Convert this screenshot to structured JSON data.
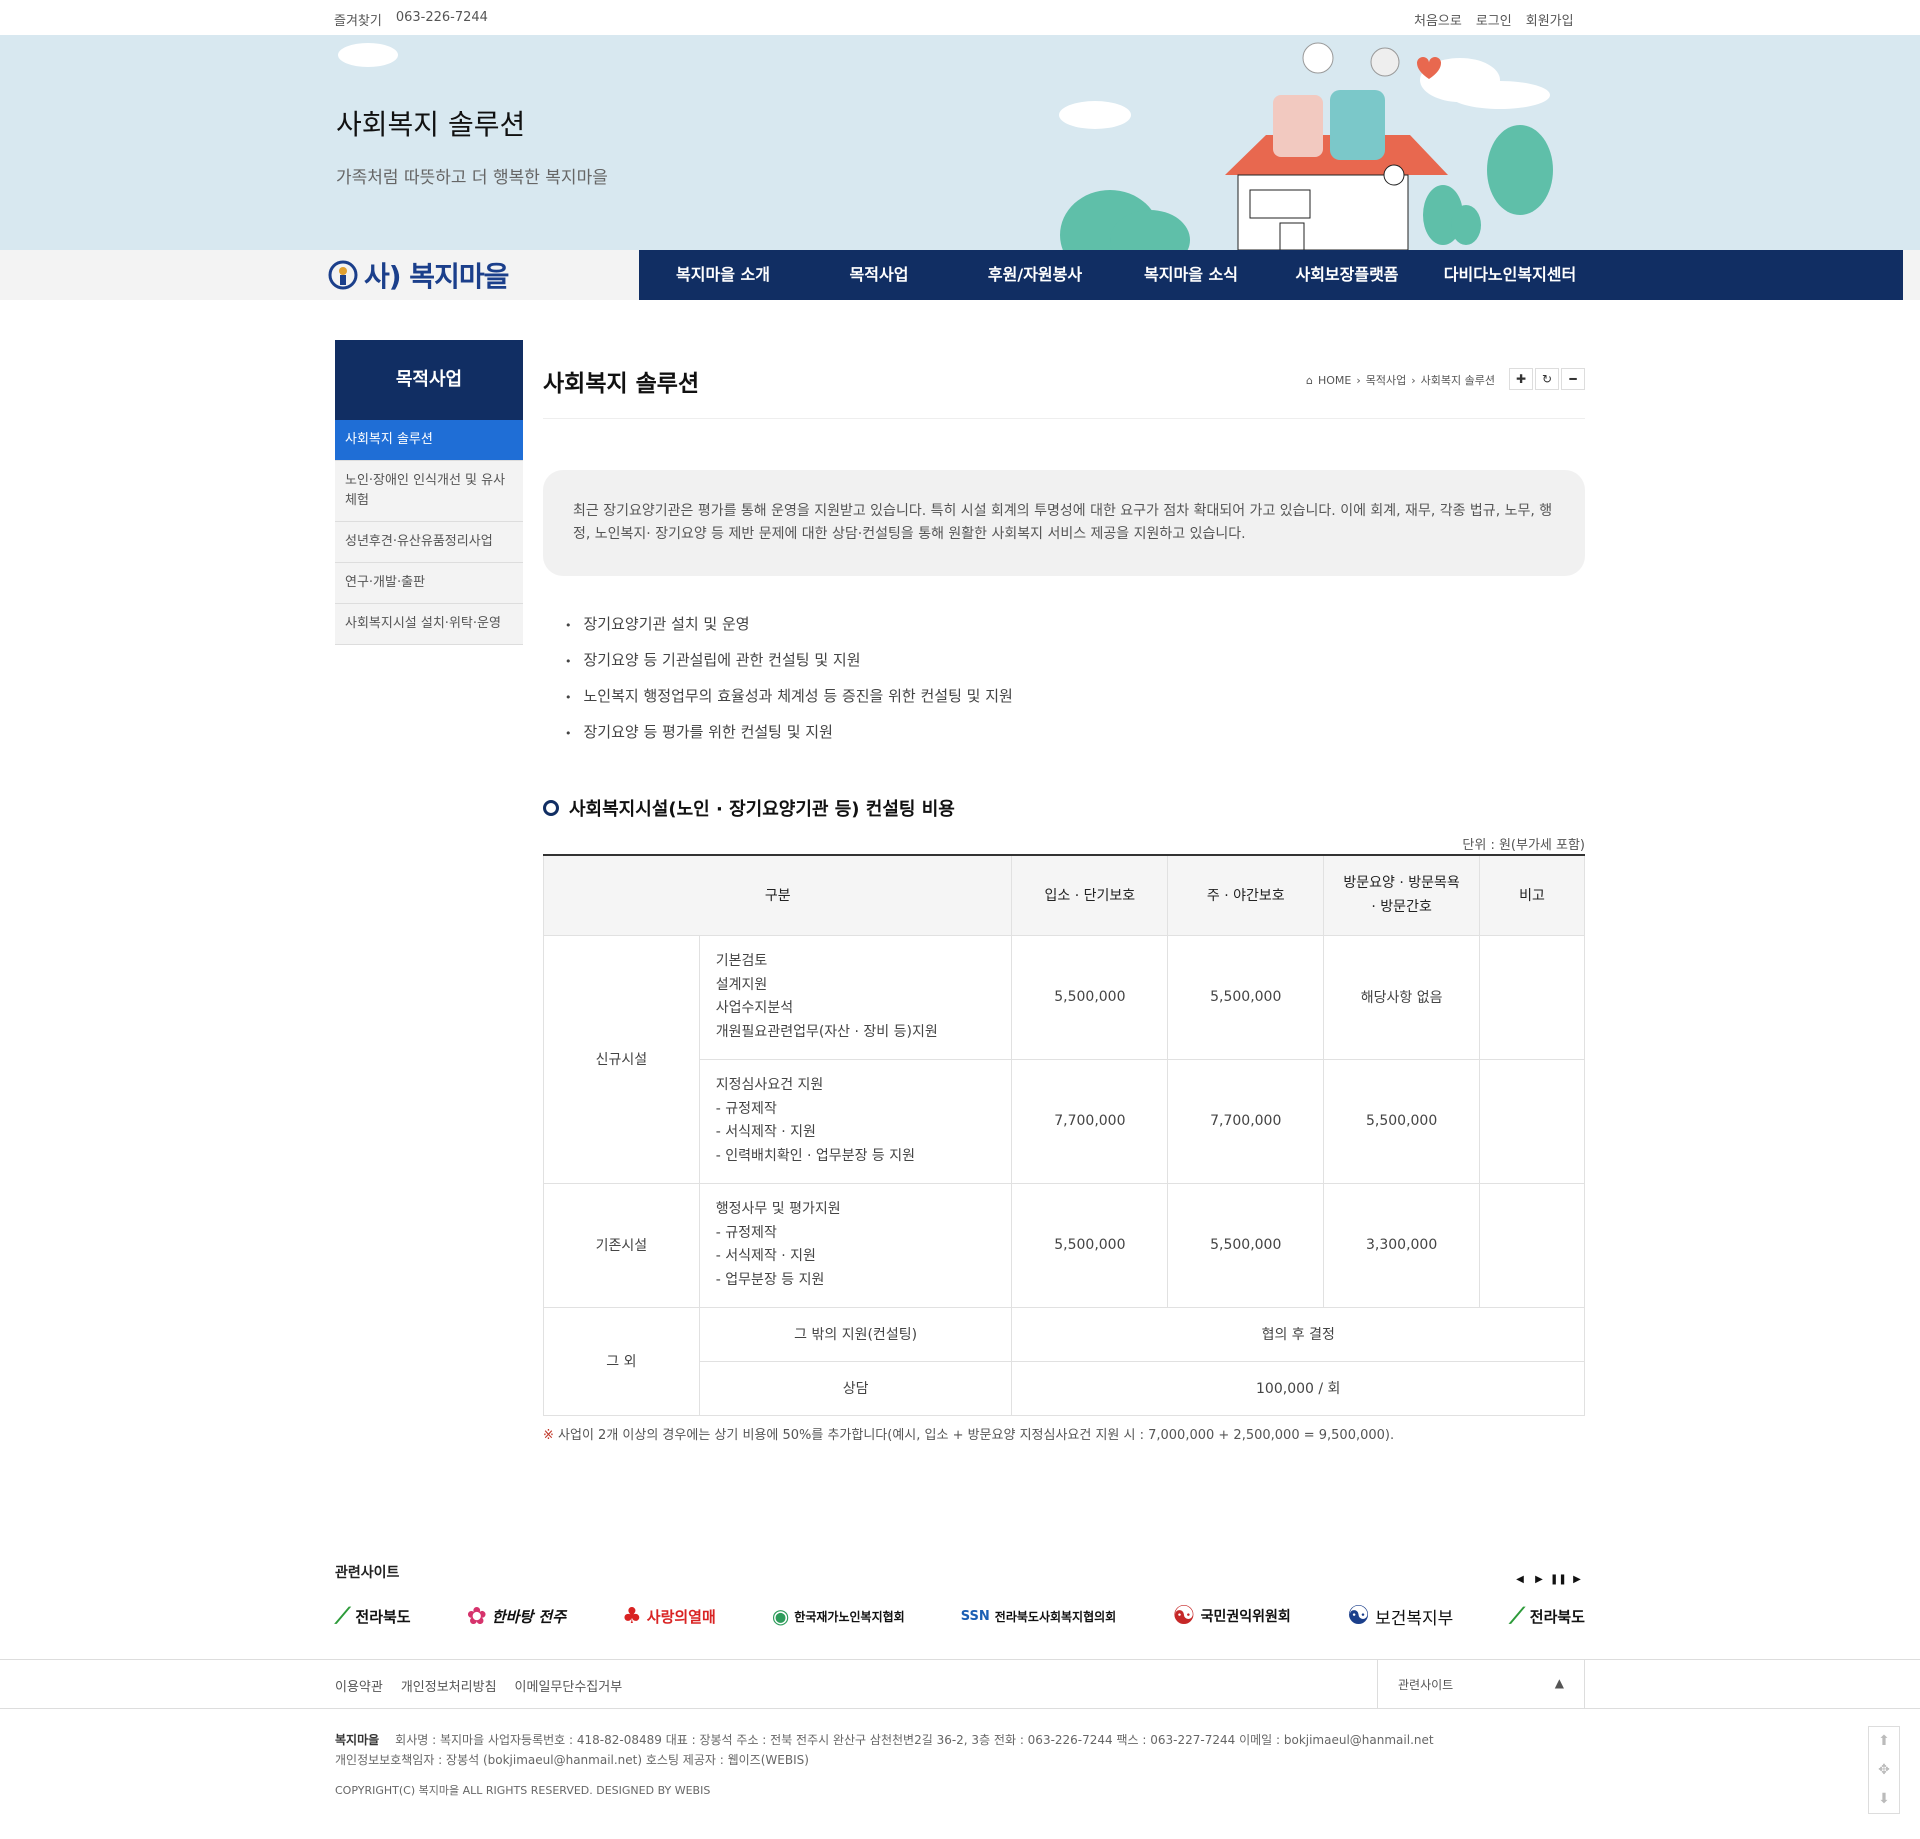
{
  "topbar": {
    "bookmark": "즐겨찾기",
    "phone": "063-226-7244",
    "home": "처음으로",
    "login": "로그인",
    "join": "회원가입"
  },
  "banner": {
    "title": "사회복지 솔루션",
    "subtitle": "가족처럼 따뜻하고 더 행복한 복지마을"
  },
  "logo": {
    "text": "사) 복지마을"
  },
  "gnb": [
    "복지마을 소개",
    "목적사업",
    "후원/자원봉사",
    "복지마을 소식",
    "사회보장플랫폼",
    "다비다노인복지센터"
  ],
  "lnb": {
    "title": "목적사업",
    "items": [
      "사회복지 솔루션",
      "노인·장애인 인식개선 및 유사체험",
      "성년후견·유산유품정리사업",
      "연구·개발·출판",
      "사회복지시설 설치·위탁·운영"
    ]
  },
  "page": {
    "title": "사회복지 솔루션",
    "breadcrumb": [
      "HOME",
      "목적사업",
      "사회복지 솔루션"
    ],
    "intro": "최근 장기요양기관은 평가를 통해 운영을 지원받고 있습니다. 특히 시설 회계의 투명성에 대한 요구가 점차 확대되어 가고 있습니다. 이에 회계, 재무, 각종 법규, 노무, 행정, 노인복지· 장기요양 등 제반 문제에 대한 상담·컨설팅을 통해 원활한 사회복지 서비스 제공을 지원하고 있습니다.",
    "bullets": [
      "장기요양기관 설치 및 운영",
      "장기요양 등 기관설립에 관한 컨설팅 및 지원",
      "노인복지 행정업무의 효율성과 체계성 등 증진을 위한 컨설팅 및 지원",
      "장기요양 등 평가를 위한 컨설팅 및 지원"
    ],
    "section_title": "사회복지시설(노인 · 장기요양기관 등) 컨설팅 비용",
    "unit": "단위 : 원(부가세 포함)",
    "table": {
      "headers": [
        "구분",
        "입소 · 단기보호",
        "주 · 야간보호",
        "방문요양 · 방문목욕 · 방문간호",
        "비고"
      ],
      "group_new": "신규시설",
      "group_existing": "기존시설",
      "group_other": "그 외",
      "rows": [
        {
          "desc": [
            "기본검토",
            "설계지원",
            "사업수지분석",
            "개원필요관련업무(자산 · 장비 등)지원"
          ],
          "a": "5,500,000",
          "b": "5,500,000",
          "c": "해당사항 없음",
          "d": ""
        },
        {
          "desc": [
            "지정심사요건 지원",
            "- 규정제작",
            "- 서식제작 · 지원",
            "- 인력배치확인 · 업무분장 등 지원"
          ],
          "a": "7,700,000",
          "b": "7,700,000",
          "c": "5,500,000",
          "d": ""
        },
        {
          "desc": [
            "행정사무 및 평가지원",
            "- 규정제작",
            "- 서식제작 · 지원",
            "- 업무분장 등 지원"
          ],
          "a": "5,500,000",
          "b": "5,500,000",
          "c": "3,300,000",
          "d": ""
        }
      ],
      "other_rows": [
        {
          "desc": "그 밖의 지원(컨설팅)",
          "value": "협의 후 결정"
        },
        {
          "desc": "상담",
          "value": "100,000 / 회"
        }
      ]
    },
    "note_mark": "※",
    "note": "사업이 2개 이상의 경우에는 상기 비용에 50%를 추가합니다(예시, 입소 + 방문요양 지정심사요건 지원 시 : 7,000,000 + 2,500,000 = 9,500,000)."
  },
  "related": {
    "title": "관련사이트",
    "logos": [
      "전라북도",
      "한바탕 전주",
      "사랑의열매",
      "한국재가노인복지협회",
      "전라북도사회복지협의회",
      "국민권익위원회",
      "보건복지부",
      "전라북도"
    ]
  },
  "footer": {
    "links": [
      "이용약관",
      "개인정보처리방침",
      "이메일무단수집거부"
    ],
    "select": "관련사이트",
    "company": "복지마을",
    "info1": "회사명 : 복지마을   사업자등록번호 : 418-82-08489   대표 : 장봉석   주소 : 전북 전주시 완산구 삼천천변2길 36-2, 3층   전화 : 063-226-7244   팩스 : 063-227-7244   이메일 : bokjimaeul@hanmail.net",
    "info2": "개인정보보호책임자 : 장봉석 (bokjimaeul@hanmail.net)   호스팅 제공자 : 웹이즈(WEBIS)",
    "copyright": "COPYRIGHT(C) 복지마을 ALL RIGHTS RESERVED. DESIGNED BY WEBIS"
  },
  "colors": {
    "navy": "#112e63",
    "active": "#1f6ed6",
    "banner": "#d8e8f0"
  }
}
